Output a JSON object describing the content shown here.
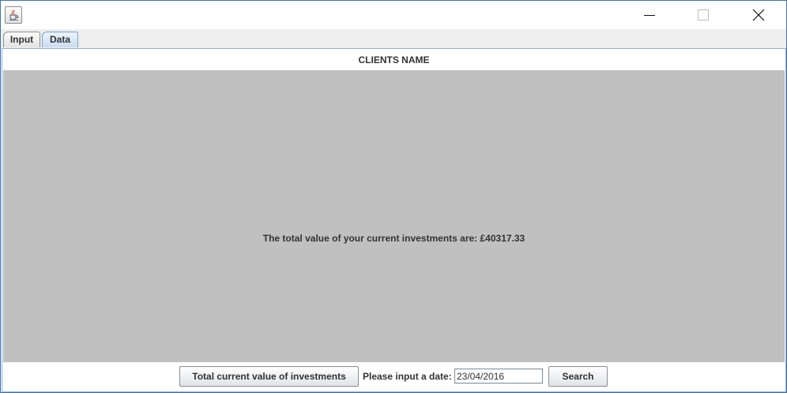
{
  "titlebar": {
    "app_icon": "java-cup-icon",
    "controls": [
      "minimize-icon",
      "maximize-icon",
      "close-icon"
    ]
  },
  "tabs": [
    {
      "label": "Input",
      "selected": false
    },
    {
      "label": "Data",
      "selected": true
    }
  ],
  "content": {
    "header": "CLIENTS NAME",
    "message": "The total value of your current investments are: £40317.33",
    "panel_color": "#c0c0c0"
  },
  "bottom_bar": {
    "total_button": "Total current value of investments",
    "date_label": "Please input a date:",
    "date_value": "23/04/2016",
    "search_button": "Search"
  }
}
